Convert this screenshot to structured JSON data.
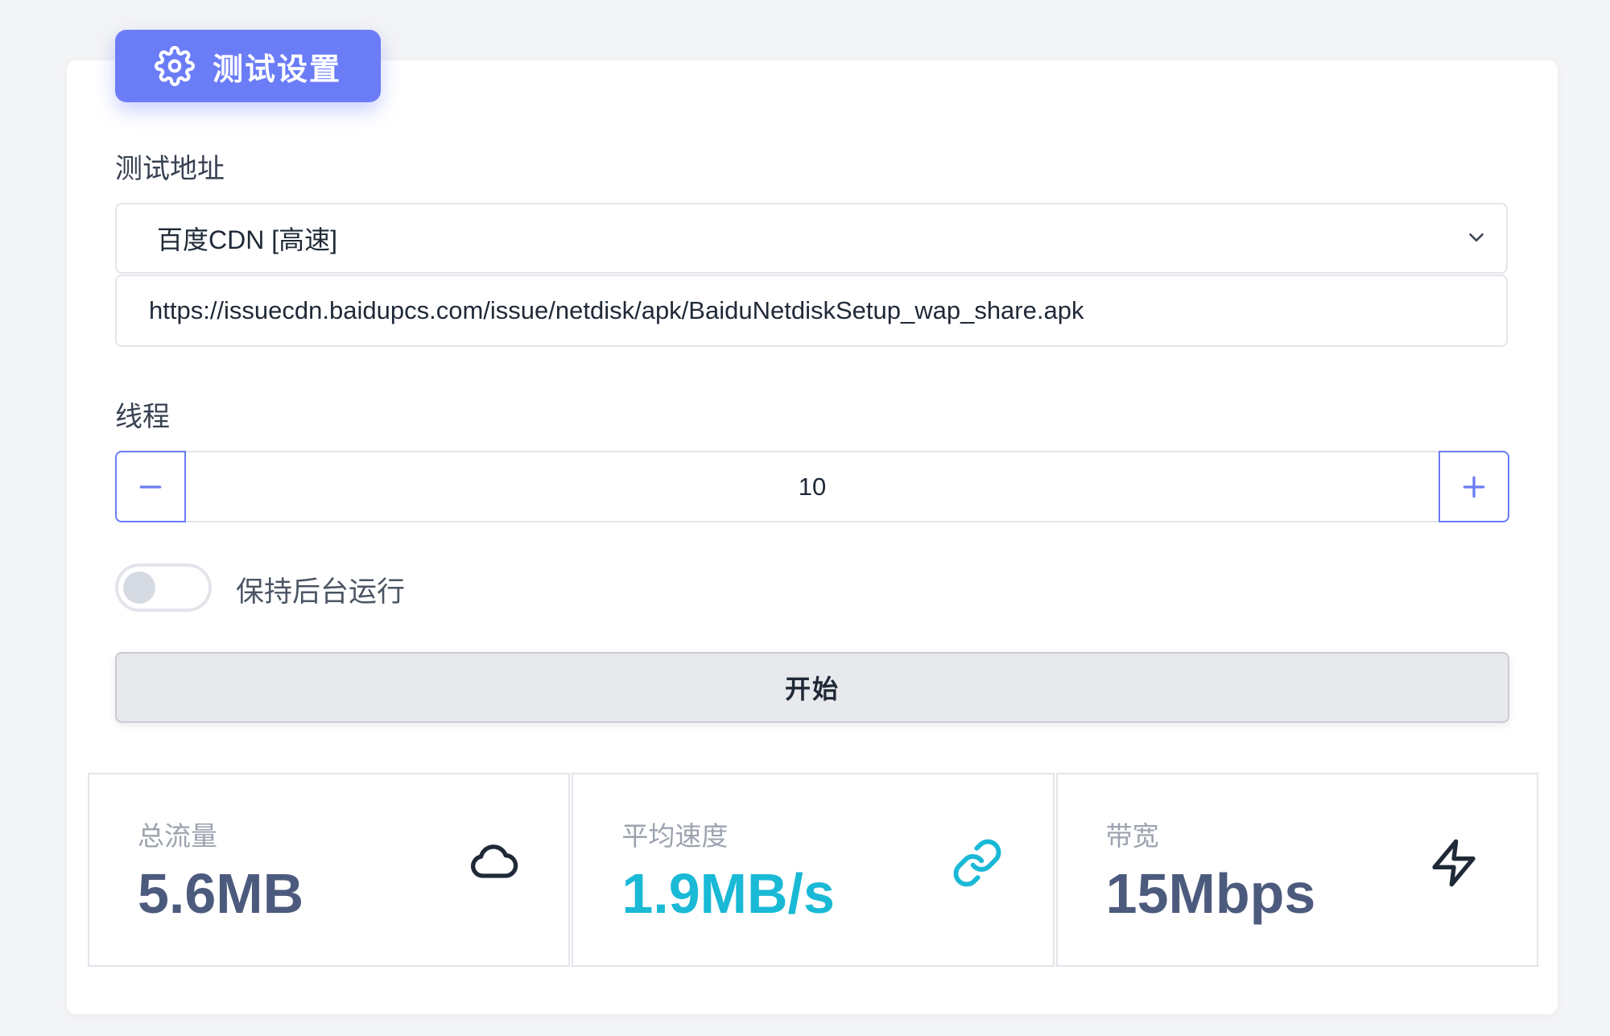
{
  "header": {
    "title": "测试设置",
    "icon": "gear-icon"
  },
  "address": {
    "label": "测试地址",
    "selected": "百度CDN [高速]",
    "url": "https://issuecdn.baidupcs.com/issue/netdisk/apk/BaiduNetdiskSetup_wap_share.apk"
  },
  "threads": {
    "label": "线程",
    "value": "10"
  },
  "background": {
    "label": "保持后台运行",
    "enabled": false
  },
  "start": {
    "label": "开始"
  },
  "stats": [
    {
      "label": "总流量",
      "value": "5.6MB",
      "icon": "cloud-icon"
    },
    {
      "label": "平均速度",
      "value": "1.9MB/s",
      "icon": "link-icon"
    },
    {
      "label": "带宽",
      "value": "15Mbps",
      "icon": "lightning-icon"
    }
  ],
  "colors": {
    "accent": "#6a7cf6",
    "speed": "#1ab9d6",
    "value": "#4c5b7d"
  }
}
